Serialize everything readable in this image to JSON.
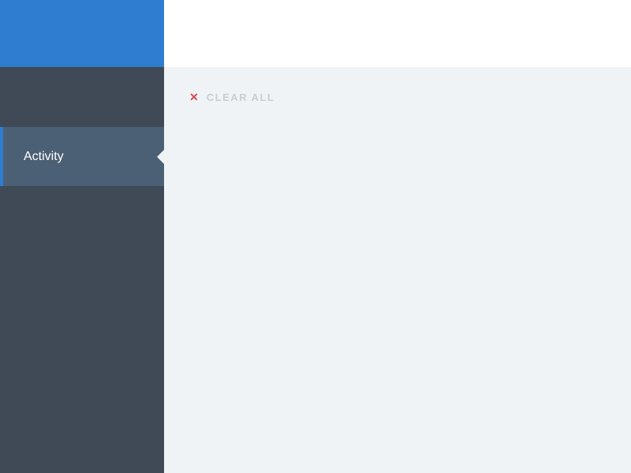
{
  "sidebar": {
    "items": [
      {
        "label": "Activity",
        "active": true
      }
    ]
  },
  "actions": {
    "clear_all_label": "CLEAR ALL"
  },
  "colors": {
    "brand": "#2f7dd0",
    "sidebar_bg": "#3f4a56",
    "sidebar_active_bg": "#4c6075",
    "content_bg": "#eff3f6",
    "danger": "#d94a4a"
  }
}
